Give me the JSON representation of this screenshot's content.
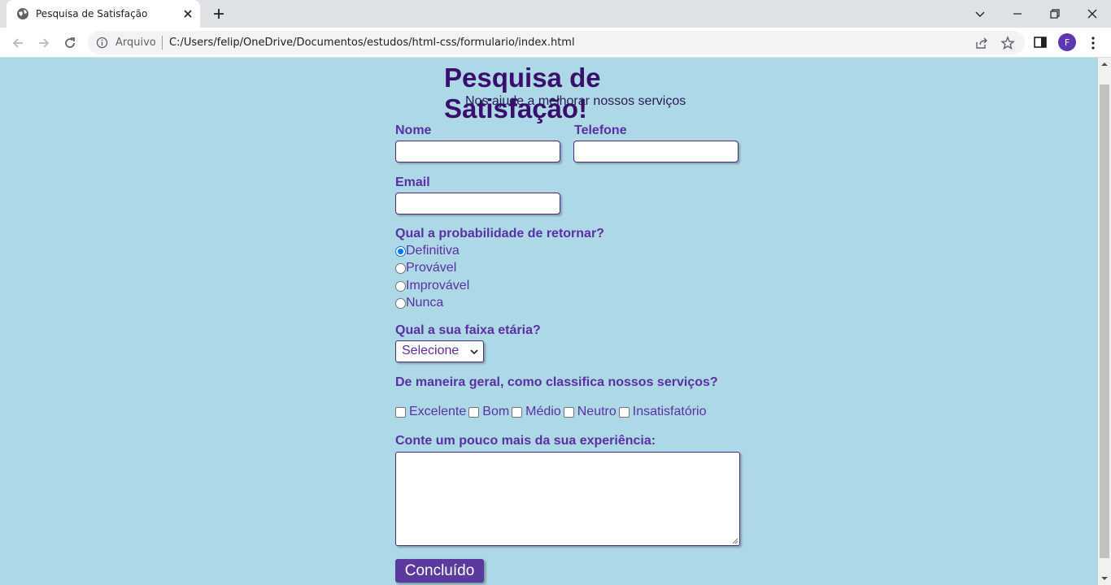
{
  "browser": {
    "tab_title": "Pesquisa de Satisfação",
    "address_scheme_label": "Arquivo",
    "address_url": "C:/Users/felip/OneDrive/Documentos/estudos/html-css/formulario/index.html",
    "profile_initial": "F"
  },
  "page": {
    "title": "Pesquisa de Satisfação!",
    "subtitle": "Nos ajude a melhorar nossos serviços",
    "fields": {
      "name_label": "Nome",
      "name_value": "",
      "phone_label": "Telefone",
      "phone_value": "",
      "email_label": "Email",
      "email_value": ""
    },
    "return_question": "Qual a probabilidade de retornar?",
    "return_options": [
      {
        "label": "Definitiva",
        "checked": true
      },
      {
        "label": "Provável",
        "checked": false
      },
      {
        "label": "Improvável",
        "checked": false
      },
      {
        "label": "Nunca",
        "checked": false
      }
    ],
    "age_question": "Qual a sua faixa etária?",
    "age_selected": "Selecione",
    "rating_question": "De maneira geral, como classifica nossos serviços?",
    "rating_options": [
      {
        "label": "Excelente",
        "checked": false
      },
      {
        "label": "Bom",
        "checked": false
      },
      {
        "label": "Médio",
        "checked": false
      },
      {
        "label": "Neutro",
        "checked": false
      },
      {
        "label": "Insatisfatório",
        "checked": false
      }
    ],
    "experience_question": "Conte um pouco mais da sua experiência:",
    "experience_value": "",
    "submit_label": "Concluído"
  },
  "colors": {
    "page_bg": "#add8e6",
    "title": "#3a0e6e",
    "label": "#5b2fa5",
    "button_bg": "#5b3a9e"
  }
}
